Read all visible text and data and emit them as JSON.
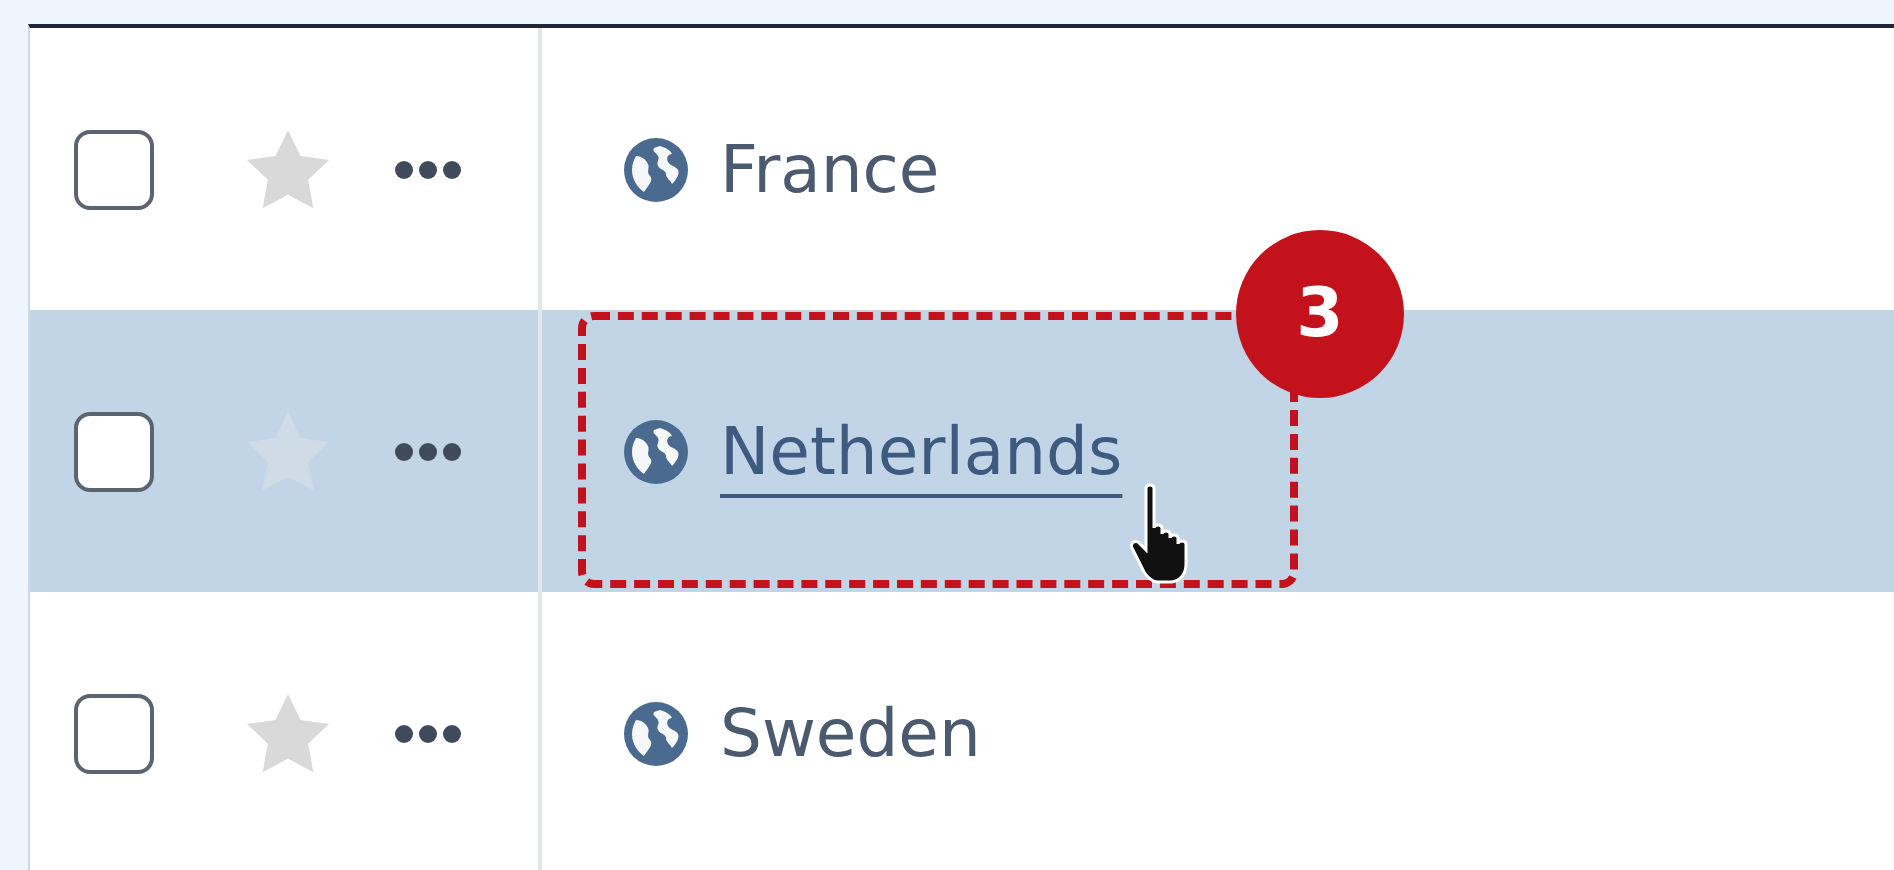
{
  "rows": [
    {
      "label": "France",
      "checked": false,
      "starred": false,
      "selected": false,
      "hovered": false
    },
    {
      "label": "Netherlands",
      "checked": false,
      "starred": false,
      "selected": true,
      "hovered": true
    },
    {
      "label": "Sweden",
      "checked": false,
      "starred": false,
      "selected": false,
      "hovered": false
    }
  ],
  "callout": {
    "number": "3"
  }
}
